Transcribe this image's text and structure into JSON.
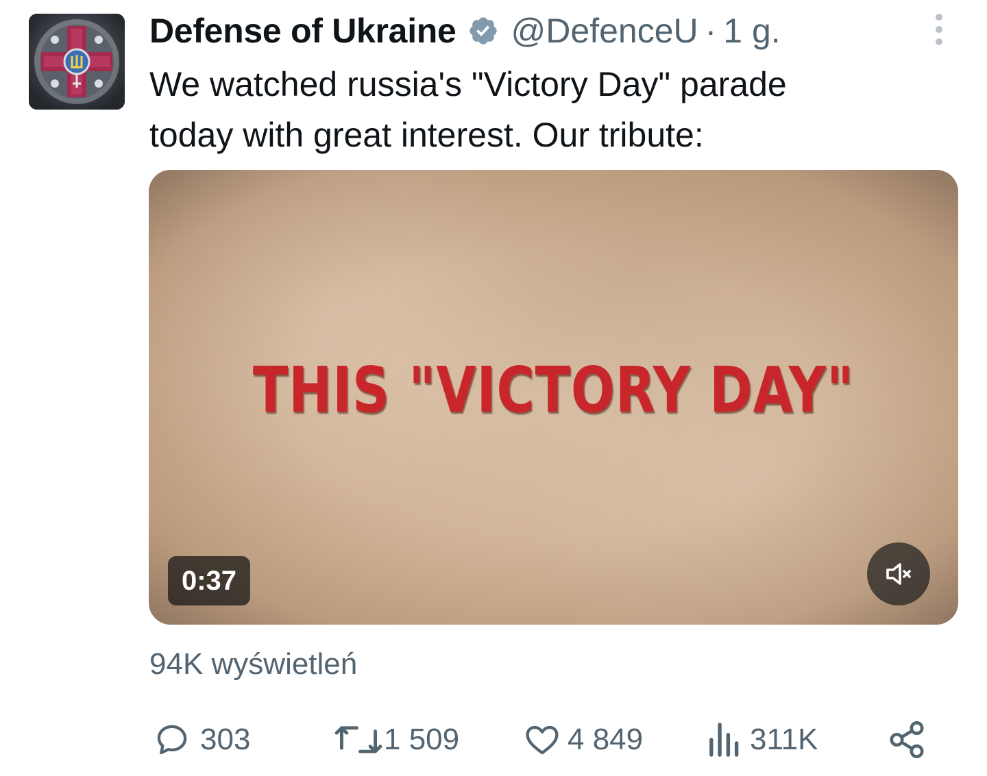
{
  "tweet": {
    "author_name": "Defense of Ukraine",
    "handle": "@DefenceU",
    "separator": "·",
    "time": "1 g.",
    "text_lines": [
      "We watched russia's \"Victory Day\" parade",
      "today with great interest. Our tribute:"
    ]
  },
  "media": {
    "title": "THIS \"VICTORY DAY\"",
    "duration": "0:37"
  },
  "views": {
    "label": "94K wyświetleń"
  },
  "actions": {
    "replies": "303",
    "retweets": "1 509",
    "likes": "4 849",
    "analytics": "311K"
  },
  "icons": {
    "verified": "verified-badge-icon",
    "more": "more-options-icon",
    "mute": "speaker-muted-icon",
    "reply": "reply-bubble-icon",
    "retweet": "retweet-icon",
    "like": "heart-icon",
    "analytics": "bar-chart-icon",
    "share": "share-icon"
  },
  "colors": {
    "text_primary": "#0f1419",
    "text_secondary": "#536471",
    "title_red": "#c8262b"
  }
}
